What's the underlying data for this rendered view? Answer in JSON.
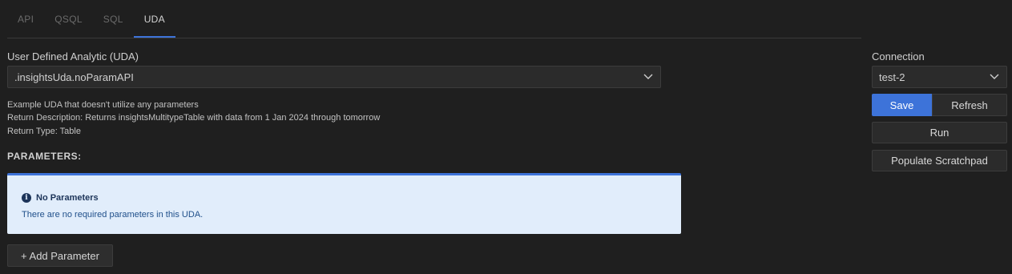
{
  "tabs": [
    {
      "label": "API",
      "active": false
    },
    {
      "label": "QSQL",
      "active": false
    },
    {
      "label": "SQL",
      "active": false
    },
    {
      "label": "UDA",
      "active": true
    }
  ],
  "uda": {
    "label": "User Defined Analytic (UDA)",
    "selected": ".insightsUda.noParamAPI",
    "description": "Example UDA that doesn't utilize any parameters",
    "return_description": "Return Description: Returns insightsMultitypeTable with data from 1 Jan 2024 through tomorrow",
    "return_type": "Return Type: Table"
  },
  "parameters": {
    "title": "PARAMETERS:",
    "notice_icon": "info-icon",
    "notice_title": "No Parameters",
    "notice_body": "There are no required parameters in this UDA.",
    "add_button": "+ Add Parameter"
  },
  "connection": {
    "label": "Connection",
    "selected": "test-2"
  },
  "actions": {
    "save": "Save",
    "refresh": "Refresh",
    "run": "Run",
    "populate": "Populate Scratchpad"
  },
  "colors": {
    "accent": "#3d73d9",
    "background": "#1f1f1f",
    "notice_bg": "#e1edfb"
  }
}
